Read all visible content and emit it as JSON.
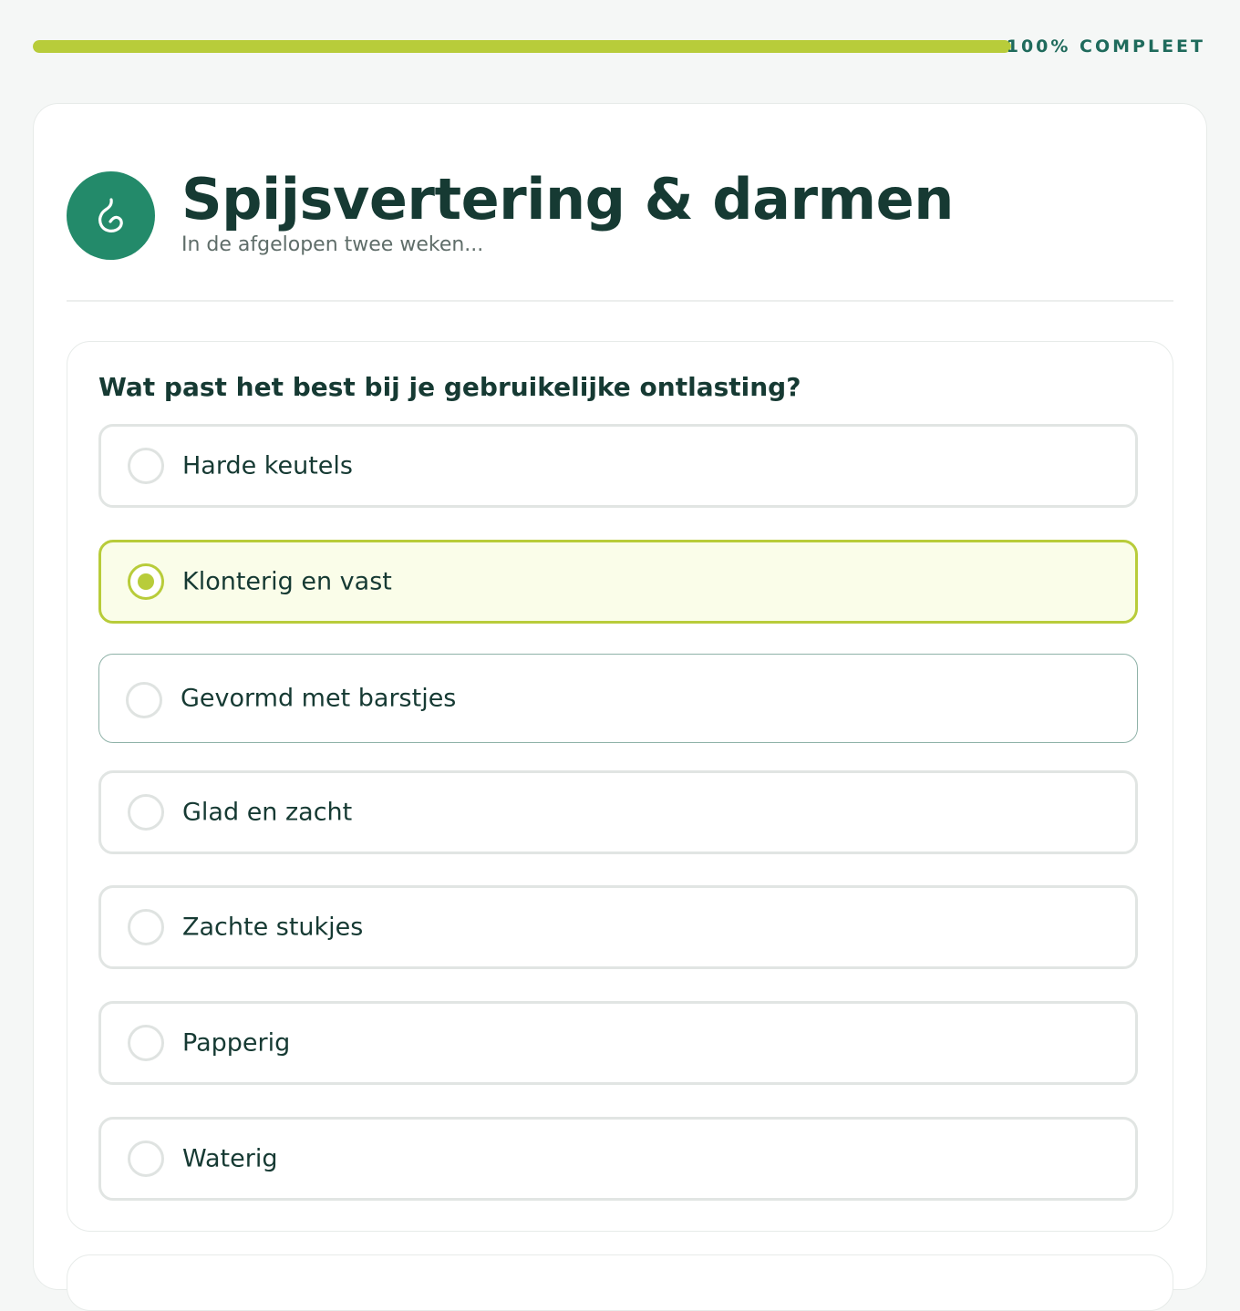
{
  "progress": {
    "percent": 100,
    "label": "100% COMPLEET",
    "fill_color": "#b8cc3a"
  },
  "section": {
    "icon": "stomach-icon",
    "title": "Spijsvertering & darmen",
    "subtitle": "In de afgelopen twee weken..."
  },
  "question": {
    "text": "Wat past het best bij je gebruikelijke ontlasting?",
    "selected_index": 1,
    "options": [
      {
        "label": "Harde keutels"
      },
      {
        "label": "Klonterig en vast"
      },
      {
        "label": "Gevormd met barstjes"
      },
      {
        "label": "Glad en zacht"
      },
      {
        "label": "Zachte stukjes"
      },
      {
        "label": "Papperig"
      },
      {
        "label": "Waterig"
      }
    ]
  },
  "colors": {
    "accent": "#b8cc3a",
    "brand": "#238a6a",
    "text": "#163a33"
  }
}
